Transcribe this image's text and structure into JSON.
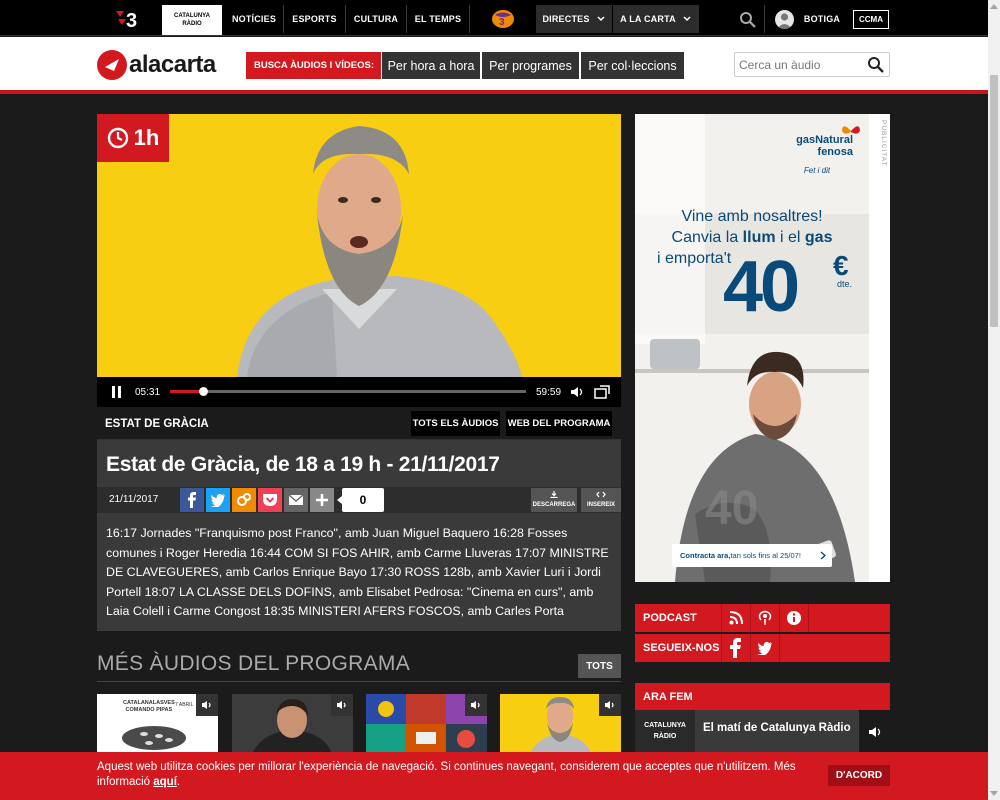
{
  "topbar": {
    "catradio_line1": "CATALUNYA",
    "catradio_line2": "RÀDIO",
    "noticies": "NOTÍCIES",
    "esports": "ESPORTS",
    "cultura": "CULTURA",
    "eltemps": "EL TEMPS",
    "directes": "DIRECTES",
    "alacarta": "A LA CARTA",
    "botiga": "BOTIGA",
    "ccma": "CCMA"
  },
  "header": {
    "logo_a": "ala",
    "logo_b": "carta",
    "busca_label": "BUSCA ÀUDIOS I VÍDEOS:",
    "nav": [
      "Per hora a hora",
      "Per programes",
      "Per col·leccions"
    ],
    "search_placeholder": "Cerca un àudio"
  },
  "player": {
    "duration_badge": "1h",
    "elapsed": "05:31",
    "total": "59:59",
    "progress": 0.092
  },
  "program": {
    "name": "ESTAT DE GRÀCIA",
    "btn_all": "TOTS ELS ÀUDIOS",
    "btn_web": "WEB DEL PROGRAMA",
    "title": "Estat de Gràcia, de 18 a 19 h - 21/11/2017",
    "date": "21/11/2017",
    "share_count": "0",
    "download_label": "DESCARREGA",
    "embed_label": "INSEREIX",
    "description": "16:17 Jornades \"Franquismo post Franco\", amb Juan Miguel Baquero 16:28 Fosses comunes i Roger Heredia 16:44 COM SI FOS AHIR, amb Carme Lluveras 17:07 MINISTRE DE CLAVEGUERES, amb Carlos Enrique Bayo 17:30 ROSS 128b, amb Xavier Luri i Jordi Portell 18:07 LA CLASSE DELS DOFINS, amb Elisabet Pedrosa: \"Cinema en curs\", amb Laia Colell i Carme Congost 18:35 MINISTERI AFERS FOSCOS, amb Carles Porta"
  },
  "more": {
    "title": "MÉS ÀUDIOS DEL PROGRAMA",
    "all_btn": "TOTS",
    "thumb1_text_a": "CATALANALASVES",
    "thumb1_text_b": "COMANDO PIPAS",
    "thumb1_text_c": "7 ABRIL"
  },
  "ad": {
    "publicitat": "PUBLICITAT",
    "brand_a": "gasNatural",
    "brand_b": "fenosa",
    "tagline": "Fet i dit",
    "line1": "Vine amb nosaltres!",
    "line2_a": "Canvia la ",
    "line2_b": "llum",
    "line2_c": " i el ",
    "line2_d": "gas",
    "line3": "i emporta't",
    "number": "40",
    "currency": "€",
    "dte": "dte.",
    "cta_bold": "Contracta ara,",
    "cta_rest": " tan sols fins al 25/07!"
  },
  "sidebar": {
    "podcast": "PODCAST",
    "segueix": "SEGUEIX-NOS",
    "arafem": "ARA FEM",
    "live_logo_a": "CATALUNYA",
    "live_logo_b": "RÀDIO",
    "live_name": "El matí de Catalunya Ràdio"
  },
  "cookie": {
    "text": "Aquest web utilitza cookies per millorar l'experiència de navegació. Si continues navegant, considerem que acceptes que n'utilitzem. Més informació",
    "link": "aquí",
    "suffix": ".",
    "button": "D'ACORD"
  },
  "colors": {
    "brand_red": "#d31920",
    "player_yellow": "#f8ce13",
    "page_bg": "#1b1b1b"
  }
}
